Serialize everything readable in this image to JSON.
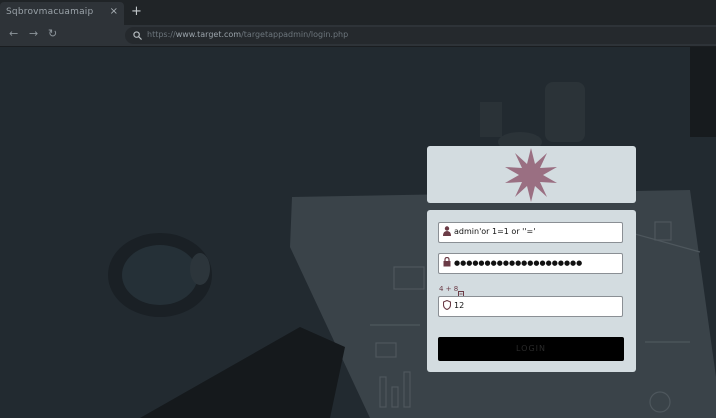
{
  "browser": {
    "tab_title": "Sqbrovmacuamaip",
    "tab_close": "×",
    "new_tab": "+",
    "nav": {
      "back": "←",
      "forward": "→",
      "reload": "↻"
    },
    "address": {
      "scheme": "https://",
      "host": "www.target.com",
      "path": "/targetappadmin/login.php"
    }
  },
  "login": {
    "username_value": "admin'or 1=1 or ''='",
    "password_value": "●●●●●●●●●●●●●●●●●●●●●",
    "captcha_question": "4 + 8",
    "captcha_answer": "12",
    "login_label": "LOGIN"
  },
  "colors": {
    "card": "#d3dce0",
    "logo_star": "#9a6f82",
    "icon": "#6b3b46",
    "button": "#000000"
  },
  "icons": [
    "user-icon",
    "lock-icon",
    "shield-icon",
    "star-logo-icon"
  ]
}
